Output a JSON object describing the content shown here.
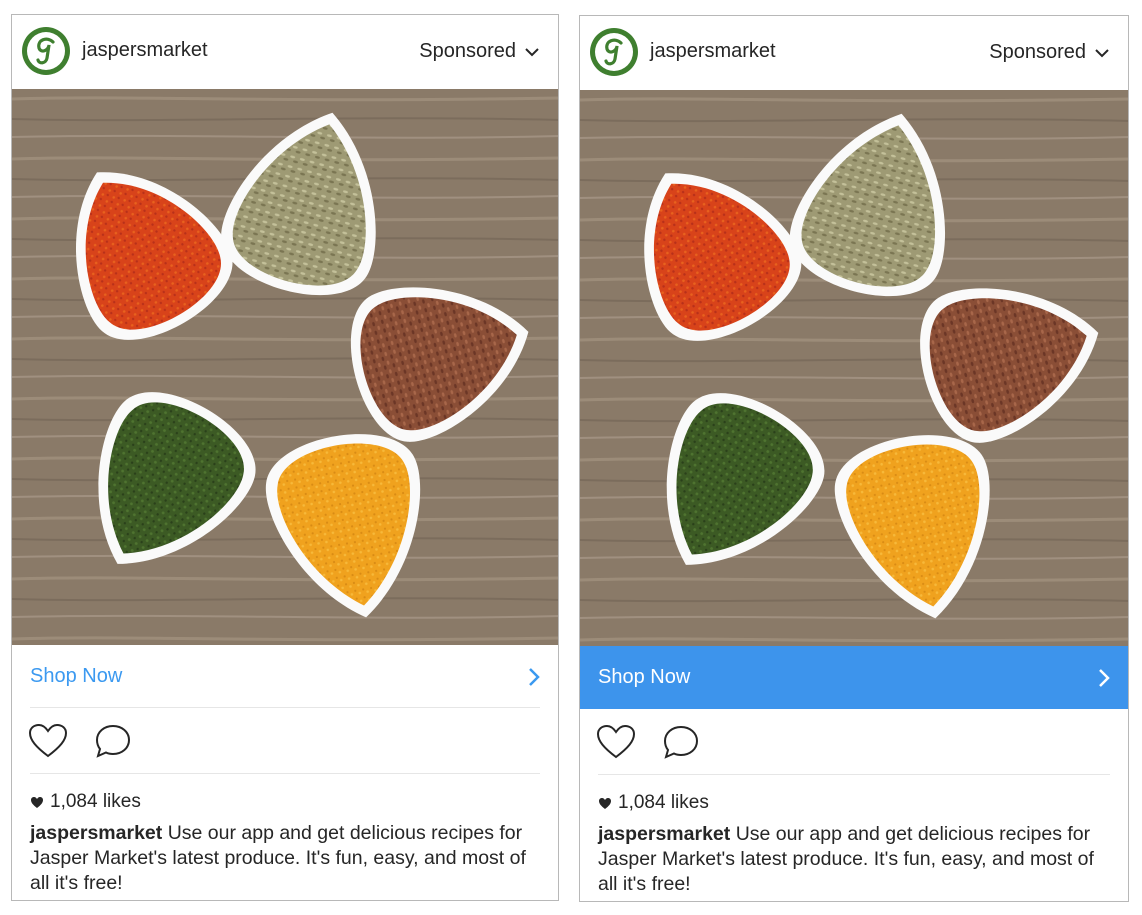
{
  "posts": [
    {
      "username": "jaspersmarket",
      "sponsored_label": "Sponsored",
      "cta_label": "Shop Now",
      "cta_state": "default",
      "likes_text": "1,084 likes",
      "caption_username": "jaspersmarket",
      "caption_text": "Use our app and get delicious recipes for Jasper Market's latest produce. It's fun, easy, and most of all it's free!"
    },
    {
      "username": "jaspersmarket",
      "sponsored_label": "Sponsored",
      "cta_label": "Shop Now",
      "cta_state": "highlighted",
      "likes_text": "1,084 likes",
      "caption_username": "jaspersmarket",
      "caption_text": "Use our app and get delicious recipes for Jasper Market's latest produce. It's fun, easy, and most of all it's free!"
    }
  ],
  "colors": {
    "brand_green": "#3f7f2f",
    "link_blue": "#3b99f0",
    "cta_blue_bg": "#3d94ec",
    "text": "#262626"
  },
  "icons": [
    "brand-logo-icon",
    "chevron-down-icon",
    "chevron-right-icon",
    "heart-icon",
    "comment-icon",
    "heart-filled-icon"
  ]
}
